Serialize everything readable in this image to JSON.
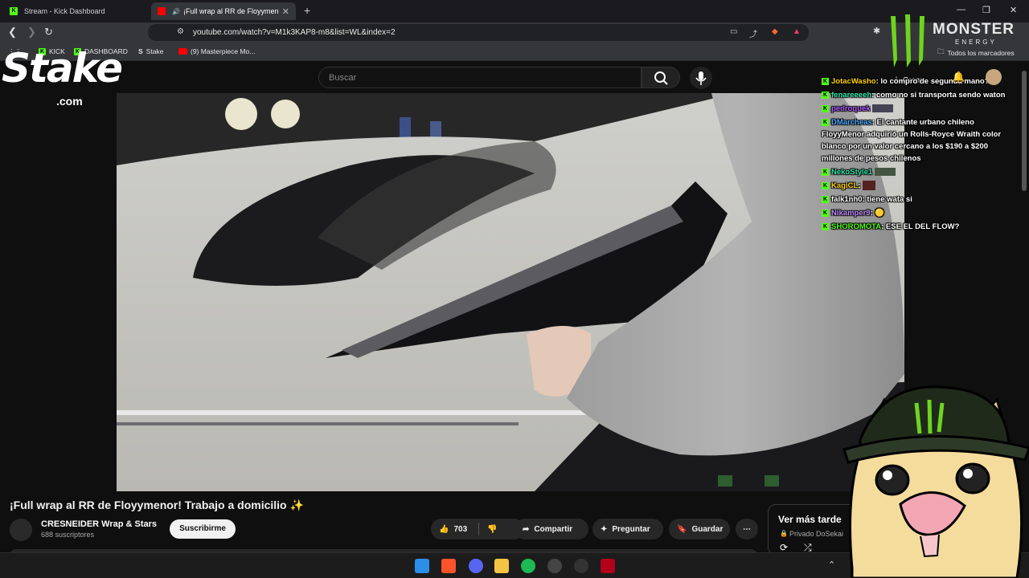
{
  "browser": {
    "tabs": [
      {
        "title": "Stream - Kick Dashboard",
        "active": false
      },
      {
        "title": "¡Full wrap al RR de Floyymenor",
        "active": true
      }
    ],
    "url": "youtube.com/watch?v=M1k3KAP8-m8&list=WL&index=2",
    "bookmarks": [
      "KICK",
      "DASHBOARD",
      "Stake",
      "(9) Masterpiece Mo..."
    ],
    "all_bookmarks": "Todos los marcadores"
  },
  "youtube": {
    "search_placeholder": "Buscar",
    "create_label": "Crear",
    "video_title": "¡Full wrap al RR de Floyymenor! Trabajo a domicilio ✨",
    "channel_name": "CRESNEIDER Wrap & Stars",
    "subscribers": "688 suscriptores",
    "subscribe_label": "Suscribirme",
    "likes": "703",
    "share_label": "Compartir",
    "ask_label": "Preguntar",
    "save_label": "Guardar",
    "watch_later_title": "Ver más tarde",
    "watch_later_sub": "Privado DoSekai"
  },
  "chat": [
    {
      "user": "JotacWasho",
      "user_color": "#ffd400",
      "text": ": lo compro de segunda mano?"
    },
    {
      "user": "fenareeeeh",
      "user_color": "#2ee6a6",
      "text": ": como no si transporta sendo waton"
    },
    {
      "user": "pedroquek",
      "user_color": "#b05cff",
      "text": ""
    },
    {
      "user": "DMarcheas",
      "user_color": "#4aa8ff",
      "text": ": El cantante urbano chileno FloyyMenor adquirió un Rolls-Royce Wraith color blanco por un valor cercano a los $190 a $200 millones de pesos chilenos"
    },
    {
      "user": "NekoStyle1",
      "user_color": "#2ee6a6",
      "text": ""
    },
    {
      "user": "KagiCL",
      "user_color": "#ffd400",
      "text": ":"
    },
    {
      "user": "falk1nh0",
      "user_color": "#ffffff",
      "text": ": tiene wata si"
    },
    {
      "user": "Nikamper9",
      "user_color": "#c08cff",
      "text": ":"
    },
    {
      "user": "SHOROMOTA",
      "user_color": "#53fc18",
      "text": ": ESE EL DEL FLOW?"
    }
  ],
  "overlays": {
    "stake_logo": "Stake",
    "stake_domain": ".com",
    "monster_brand": "MONSTER",
    "monster_sub": "ENERGY"
  },
  "colors": {
    "kick_green": "#53fc18",
    "youtube_red": "#ff0000",
    "bg": "#0f0f0f"
  }
}
